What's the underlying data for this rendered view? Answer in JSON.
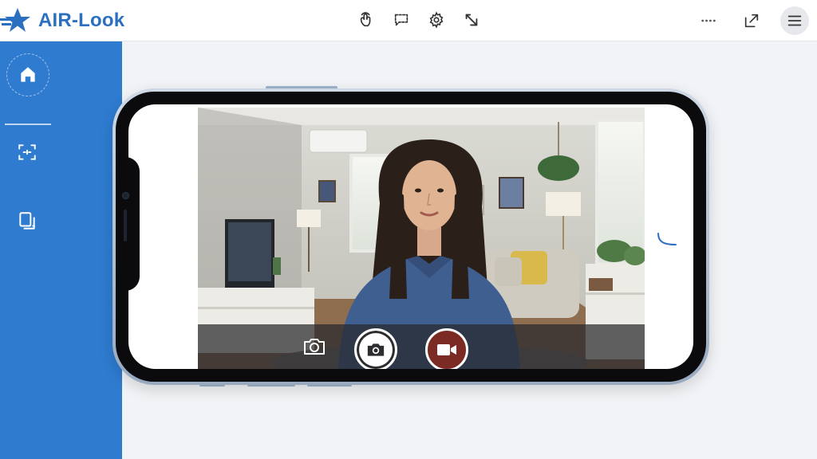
{
  "app": {
    "name": "AIR-Look",
    "brand_color": "#2a6fc0",
    "sidebar_color": "#2e7bd0"
  },
  "header": {
    "tools": [
      {
        "icon": "touch-icon"
      },
      {
        "icon": "chat-icon"
      },
      {
        "icon": "settings-gear-icon"
      },
      {
        "icon": "pointer-arrow-icon"
      }
    ],
    "right": [
      {
        "icon": "more-dots-icon"
      },
      {
        "icon": "external-link-icon"
      },
      {
        "icon": "hamburger-menu-icon"
      }
    ]
  },
  "sidebar": {
    "items": [
      {
        "icon": "home-icon",
        "active": true
      },
      {
        "icon": "screen-capture-icon"
      },
      {
        "icon": "multi-screen-icon"
      }
    ]
  },
  "camera": {
    "controls": [
      {
        "icon": "camera-icon"
      },
      {
        "icon": "take-photo-icon"
      },
      {
        "icon": "record-video-icon",
        "color": "#7b2a24"
      }
    ]
  }
}
